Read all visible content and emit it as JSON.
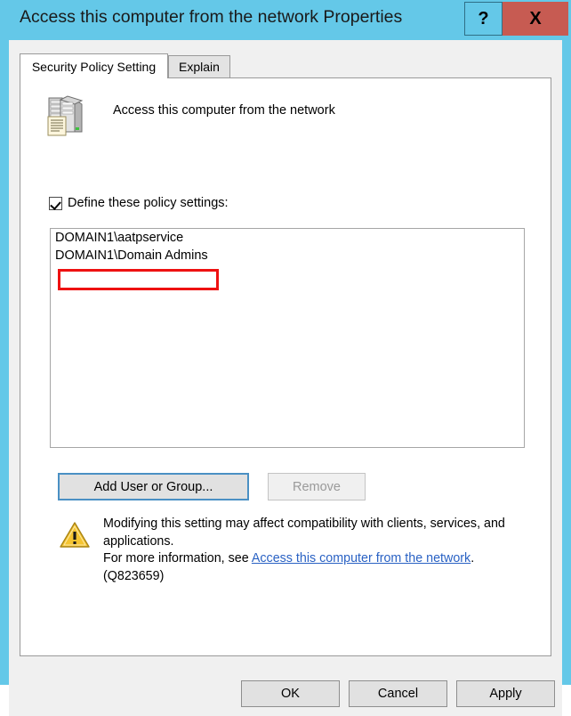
{
  "window": {
    "title": "Access this computer from the network Properties",
    "titlebar_color": "#64c8e8",
    "close_button_color": "#c75b52",
    "help_label": "?",
    "close_label": "X"
  },
  "tabs": [
    {
      "label": "Security Policy Setting",
      "active": true
    },
    {
      "label": "Explain",
      "active": false
    }
  ],
  "policy": {
    "icon": "server-policy-icon",
    "name": "Access this computer from the network"
  },
  "define_setting": {
    "label": "Define these policy settings:",
    "checked": true
  },
  "listbox": {
    "items": [
      {
        "text": "DOMAIN1\\aatpservice",
        "annotated": true
      },
      {
        "text": "DOMAIN1\\Domain Admins",
        "annotated": false
      }
    ]
  },
  "annotation": {
    "color": "#ee1111",
    "target": "DOMAIN1\\aatpservice"
  },
  "actions": {
    "add_user_label": "Add User or Group...",
    "remove_label": "Remove",
    "remove_enabled": false
  },
  "warning": {
    "icon": "warning-triangle-icon",
    "line1": "Modifying this setting may affect compatibility with clients, services,",
    "line2": "and applications.",
    "line3_prefix": "For more information, see ",
    "link_text": "Access this computer from the network",
    "line3_suffix": ".",
    "line4": "(Q823659)",
    "link_color": "#2a62c4"
  },
  "dialog_buttons": {
    "ok": "OK",
    "cancel": "Cancel",
    "apply": "Apply"
  }
}
